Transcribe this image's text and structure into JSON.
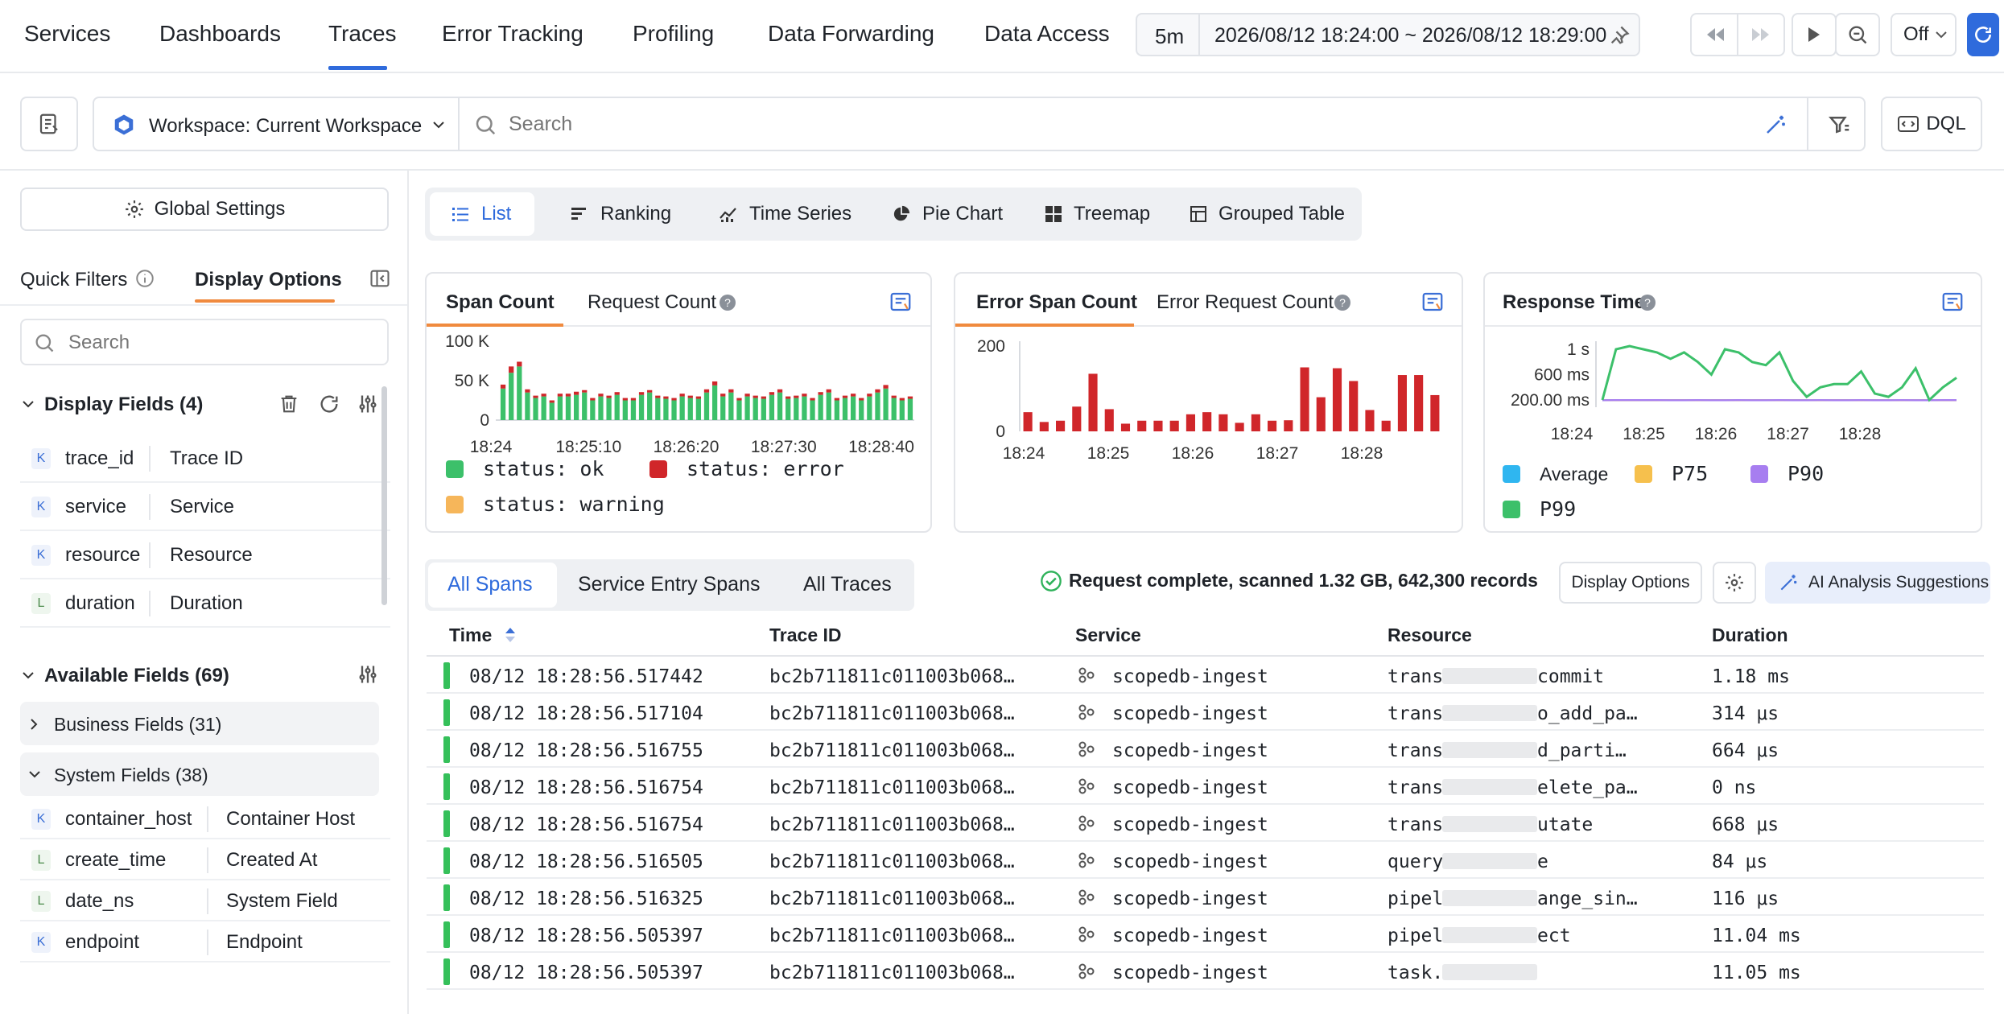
{
  "nav": {
    "tabs": [
      "Services",
      "Dashboards",
      "Traces",
      "Error Tracking",
      "Profiling",
      "Data Forwarding",
      "Data Access"
    ],
    "active": "Traces",
    "time_quick": "5m",
    "time_range": "2026/08/12 18:24:00 ~ 2026/08/12 18:29:00",
    "refresh_mode": "Off"
  },
  "toolbar": {
    "workspace": "Workspace: Current Workspace",
    "search_placeholder": "Search",
    "dql_label": "DQL"
  },
  "sidebar": {
    "global_settings": "Global Settings",
    "tab_quick_filters": "Quick Filters",
    "tab_display_options": "Display Options",
    "search_placeholder": "Search",
    "display_fields_title": "Display Fields (4)",
    "display_fields": [
      {
        "type": "K",
        "name": "trace_id",
        "label": "Trace ID"
      },
      {
        "type": "K",
        "name": "service",
        "label": "Service"
      },
      {
        "type": "K",
        "name": "resource",
        "label": "Resource"
      },
      {
        "type": "L",
        "name": "duration",
        "label": "Duration"
      }
    ],
    "available_fields_title": "Available Fields (69)",
    "business_fields": "Business Fields (31)",
    "system_fields": "System Fields (38)",
    "system_field_items": [
      {
        "type": "K",
        "name": "container_host",
        "label": "Container Host"
      },
      {
        "type": "L",
        "name": "create_time",
        "label": "Created At"
      },
      {
        "type": "L",
        "name": "date_ns",
        "label": "System Field"
      },
      {
        "type": "K",
        "name": "endpoint",
        "label": "Endpoint"
      }
    ]
  },
  "view_tabs": [
    "List",
    "Ranking",
    "Time Series",
    "Pie Chart",
    "Treemap",
    "Grouped Table"
  ],
  "view_active": "List",
  "cards": {
    "span": {
      "tab1": "Span Count",
      "tab2": "Request Count"
    },
    "error": {
      "tab1": "Error Span Count",
      "tab2": "Error Request Count"
    },
    "resp": {
      "title": "Response Time"
    }
  },
  "chart_data": [
    {
      "type": "bar",
      "title": "Span Count",
      "stacked": true,
      "y_ticks": [
        "100 K",
        "50 K",
        "0"
      ],
      "ylim": [
        0,
        100000
      ],
      "x_ticks": [
        "18:24",
        "18:25:10",
        "18:26:20",
        "18:27:30",
        "18:28:40"
      ],
      "series": [
        {
          "name": "status: ok",
          "color": "#3cc06a",
          "values": [
            40000,
            60000,
            68000,
            35000,
            28000,
            30000,
            22000,
            30000,
            30000,
            32000,
            35000,
            25000,
            30000,
            28000,
            32000,
            25000,
            25000,
            32000,
            35000,
            28000,
            27000,
            25000,
            30000,
            28000,
            27000,
            35000,
            44000,
            30000,
            35000,
            25000,
            30000,
            28000,
            27000,
            32000,
            35000,
            27000,
            28000,
            30000,
            25000,
            32000,
            35000,
            25000,
            28000,
            30000,
            25000,
            30000,
            35000,
            40000,
            28000,
            25000,
            27000
          ]
        },
        {
          "name": "status: error",
          "color": "#d0262a",
          "values": [
            5000,
            8000,
            6000,
            4000,
            3000,
            3500,
            3000,
            3500,
            3500,
            4000,
            3000,
            3000,
            3500,
            3000,
            3500,
            3000,
            3000,
            3500,
            3000,
            3000,
            3000,
            3000,
            3500,
            3000,
            3000,
            4000,
            5000,
            3500,
            4000,
            3000,
            3500,
            3000,
            3000,
            3500,
            4000,
            3000,
            3000,
            3500,
            3000,
            3500,
            4000,
            3000,
            3000,
            3500,
            3000,
            3500,
            4000,
            4500,
            3000,
            3000,
            3000
          ]
        },
        {
          "name": "status: warning",
          "color": "#f6b65a",
          "values": [
            0,
            0,
            0,
            0,
            0,
            0,
            0,
            0,
            0,
            0,
            0,
            0,
            0,
            0,
            0,
            0,
            0,
            0,
            0,
            0,
            0,
            0,
            0,
            0,
            0,
            0,
            0,
            0,
            0,
            0,
            0,
            0,
            0,
            0,
            0,
            0,
            0,
            0,
            0,
            0,
            0,
            0,
            0,
            0,
            0,
            0,
            0,
            0,
            0,
            0,
            0
          ]
        }
      ]
    },
    {
      "type": "bar",
      "title": "Error Span Count",
      "y_ticks": [
        "200",
        "0"
      ],
      "ylim": [
        0,
        200
      ],
      "x_ticks": [
        "18:24",
        "18:25",
        "18:26",
        "18:27",
        "18:28"
      ],
      "series": [
        {
          "name": "status: error",
          "color": "#d0262a",
          "values": [
            45,
            22,
            25,
            58,
            135,
            52,
            18,
            25,
            25,
            25,
            40,
            45,
            40,
            20,
            40,
            25,
            26,
            150,
            80,
            148,
            118,
            50,
            25,
            132,
            132,
            85
          ]
        }
      ]
    },
    {
      "type": "line",
      "title": "Response Time",
      "y_ticks": [
        "1 s",
        "600 ms",
        "200.00 ms"
      ],
      "x_ticks": [
        "18:24",
        "18:25",
        "18:26",
        "18:27",
        "18:28"
      ],
      "series": [
        {
          "name": "Average",
          "color": "#2fb6f0",
          "values": [
            100,
            100,
            110,
            125,
            110,
            100,
            100,
            100,
            100,
            100,
            100,
            100,
            100,
            100,
            100,
            100,
            100,
            100,
            100,
            100,
            100,
            100,
            100,
            100,
            100,
            100,
            100
          ]
        },
        {
          "name": "P75",
          "color": "#f6c04d",
          "values": [
            110,
            110,
            120,
            130,
            120,
            110,
            110,
            110,
            110,
            110,
            110,
            110,
            110,
            110,
            110,
            110,
            110,
            110,
            110,
            110,
            110,
            110,
            110,
            110,
            110,
            110,
            110
          ]
        },
        {
          "name": "P90",
          "color": "#a77ef0",
          "values": [
            120,
            125,
            130,
            135,
            130,
            120,
            120,
            125,
            120,
            120,
            125,
            120,
            120,
            125,
            120,
            120,
            125,
            120,
            120,
            125,
            120,
            120,
            125,
            120,
            120,
            125,
            130
          ]
        },
        {
          "name": "P99",
          "color": "#3cc06a",
          "values": [
            200,
            1000,
            1050,
            1000,
            950,
            850,
            950,
            800,
            600,
            1000,
            950,
            800,
            750,
            950,
            500,
            250,
            400,
            450,
            450,
            650,
            300,
            250,
            400,
            700,
            200,
            400,
            550
          ]
        }
      ]
    }
  ],
  "list": {
    "tabs": [
      "All Spans",
      "Service Entry Spans",
      "All Traces"
    ],
    "active": "All Spans",
    "status": "Request complete, scanned 1.32 GB, 642,300 records",
    "display_options": "Display Options",
    "ai_button": "AI Analysis Suggestions",
    "columns": [
      "Time",
      "Trace ID",
      "Service",
      "Resource",
      "Duration"
    ],
    "rows": [
      {
        "time": "08/12 18:28:56.517442",
        "trace": "bc2b711811c011003b068…",
        "service": "scopedb-ingest",
        "res_a": "trans",
        "res_b": "commit",
        "duration": "1.18 ms"
      },
      {
        "time": "08/12 18:28:56.517104",
        "trace": "bc2b711811c011003b068…",
        "service": "scopedb-ingest",
        "res_a": "trans",
        "res_b": "o_add_pa…",
        "duration": "314 μs"
      },
      {
        "time": "08/12 18:28:56.516755",
        "trace": "bc2b711811c011003b068…",
        "service": "scopedb-ingest",
        "res_a": "trans",
        "res_b": "d_parti…",
        "duration": "664 μs"
      },
      {
        "time": "08/12 18:28:56.516754",
        "trace": "bc2b711811c011003b068…",
        "service": "scopedb-ingest",
        "res_a": "trans",
        "res_b": "elete_pa…",
        "duration": "0 ns"
      },
      {
        "time": "08/12 18:28:56.516754",
        "trace": "bc2b711811c011003b068…",
        "service": "scopedb-ingest",
        "res_a": "trans",
        "res_b": "utate",
        "duration": "668 μs"
      },
      {
        "time": "08/12 18:28:56.516505",
        "trace": "bc2b711811c011003b068…",
        "service": "scopedb-ingest",
        "res_a": "query",
        "res_b": "e",
        "duration": "84 μs"
      },
      {
        "time": "08/12 18:28:56.516325",
        "trace": "bc2b711811c011003b068…",
        "service": "scopedb-ingest",
        "res_a": "pipel",
        "res_b": "ange_sin…",
        "duration": "116 μs"
      },
      {
        "time": "08/12 18:28:56.505397",
        "trace": "bc2b711811c011003b068…",
        "service": "scopedb-ingest",
        "res_a": "pipel",
        "res_b": "ect",
        "duration": "11.04 ms"
      },
      {
        "time": "08/12 18:28:56.505397",
        "trace": "bc2b711811c011003b068…",
        "service": "scopedb-ingest",
        "res_a": "task.",
        "res_b": "",
        "duration": "11.05 ms"
      }
    ]
  },
  "colors": {
    "accent": "#2f6bdc",
    "tab_underline": "#f08a3e",
    "ok": "#3cc06a",
    "error": "#d0262a",
    "warning": "#f6b65a"
  }
}
